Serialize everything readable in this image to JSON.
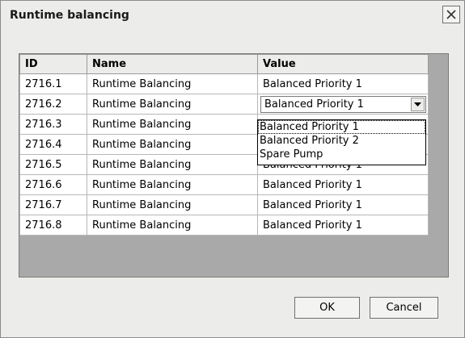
{
  "window": {
    "title": "Runtime balancing"
  },
  "table": {
    "headers": {
      "id": "ID",
      "name": "Name",
      "value": "Value"
    },
    "rows": [
      {
        "id": "2716.1",
        "name": "Runtime Balancing",
        "value": "Balanced Priority 1"
      },
      {
        "id": "2716.2",
        "name": "Runtime Balancing",
        "value": "Balanced Priority 1"
      },
      {
        "id": "2716.3",
        "name": "Runtime Balancing",
        "value": ""
      },
      {
        "id": "2716.4",
        "name": "Runtime Balancing",
        "value": ""
      },
      {
        "id": "2716.5",
        "name": "Runtime Balancing",
        "value": "Balanced Priority 1"
      },
      {
        "id": "2716.6",
        "name": "Runtime Balancing",
        "value": "Balanced Priority 1"
      },
      {
        "id": "2716.7",
        "name": "Runtime Balancing",
        "value": "Balanced Priority 1"
      },
      {
        "id": "2716.8",
        "name": "Runtime Balancing",
        "value": "Balanced Priority 1"
      }
    ]
  },
  "dropdown": {
    "options": [
      "Balanced Priority 1",
      "Balanced Priority 2",
      "Spare Pump"
    ],
    "selected_index": 0
  },
  "buttons": {
    "ok": "OK",
    "cancel": "Cancel"
  },
  "icons": {
    "close": "close-icon",
    "dropdown_arrow": "chevron-down-icon"
  }
}
